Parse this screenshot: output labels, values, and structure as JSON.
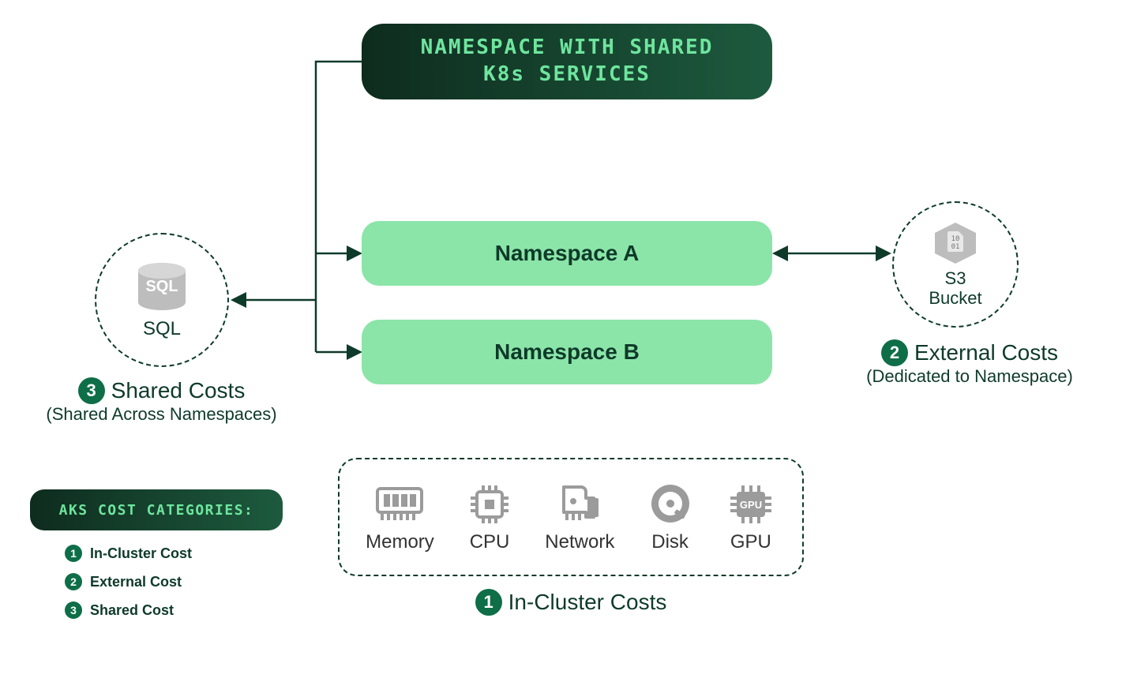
{
  "header": {
    "line1": "NAMESPACE WITH SHARED",
    "line2": "K8s SERVICES"
  },
  "namespaces": {
    "a": "Namespace A",
    "b": "Namespace B"
  },
  "sql": {
    "icon_label": "SQL",
    "inside_label": "SQL",
    "badge": "3",
    "title": "Shared Costs",
    "subtitle": "(Shared Across Namespaces)"
  },
  "s3": {
    "line1": "S3",
    "line2": "Bucket",
    "hex_text": "10\n01",
    "badge": "2",
    "title": "External Costs",
    "subtitle": "(Dedicated to Namespace)"
  },
  "resources": {
    "items": [
      {
        "label": "Memory",
        "icon": "memory-icon"
      },
      {
        "label": "CPU",
        "icon": "cpu-icon"
      },
      {
        "label": "Network",
        "icon": "network-icon"
      },
      {
        "label": "Disk",
        "icon": "disk-icon"
      },
      {
        "label": "GPU",
        "icon": "gpu-icon"
      }
    ],
    "badge": "1",
    "label": "In-Cluster Costs"
  },
  "legend": {
    "title": "AKS COST CATEGORIES:",
    "items": [
      {
        "num": "1",
        "label": "In-Cluster Cost"
      },
      {
        "num": "2",
        "label": "External Cost"
      },
      {
        "num": "3",
        "label": "Shared Cost"
      }
    ]
  }
}
